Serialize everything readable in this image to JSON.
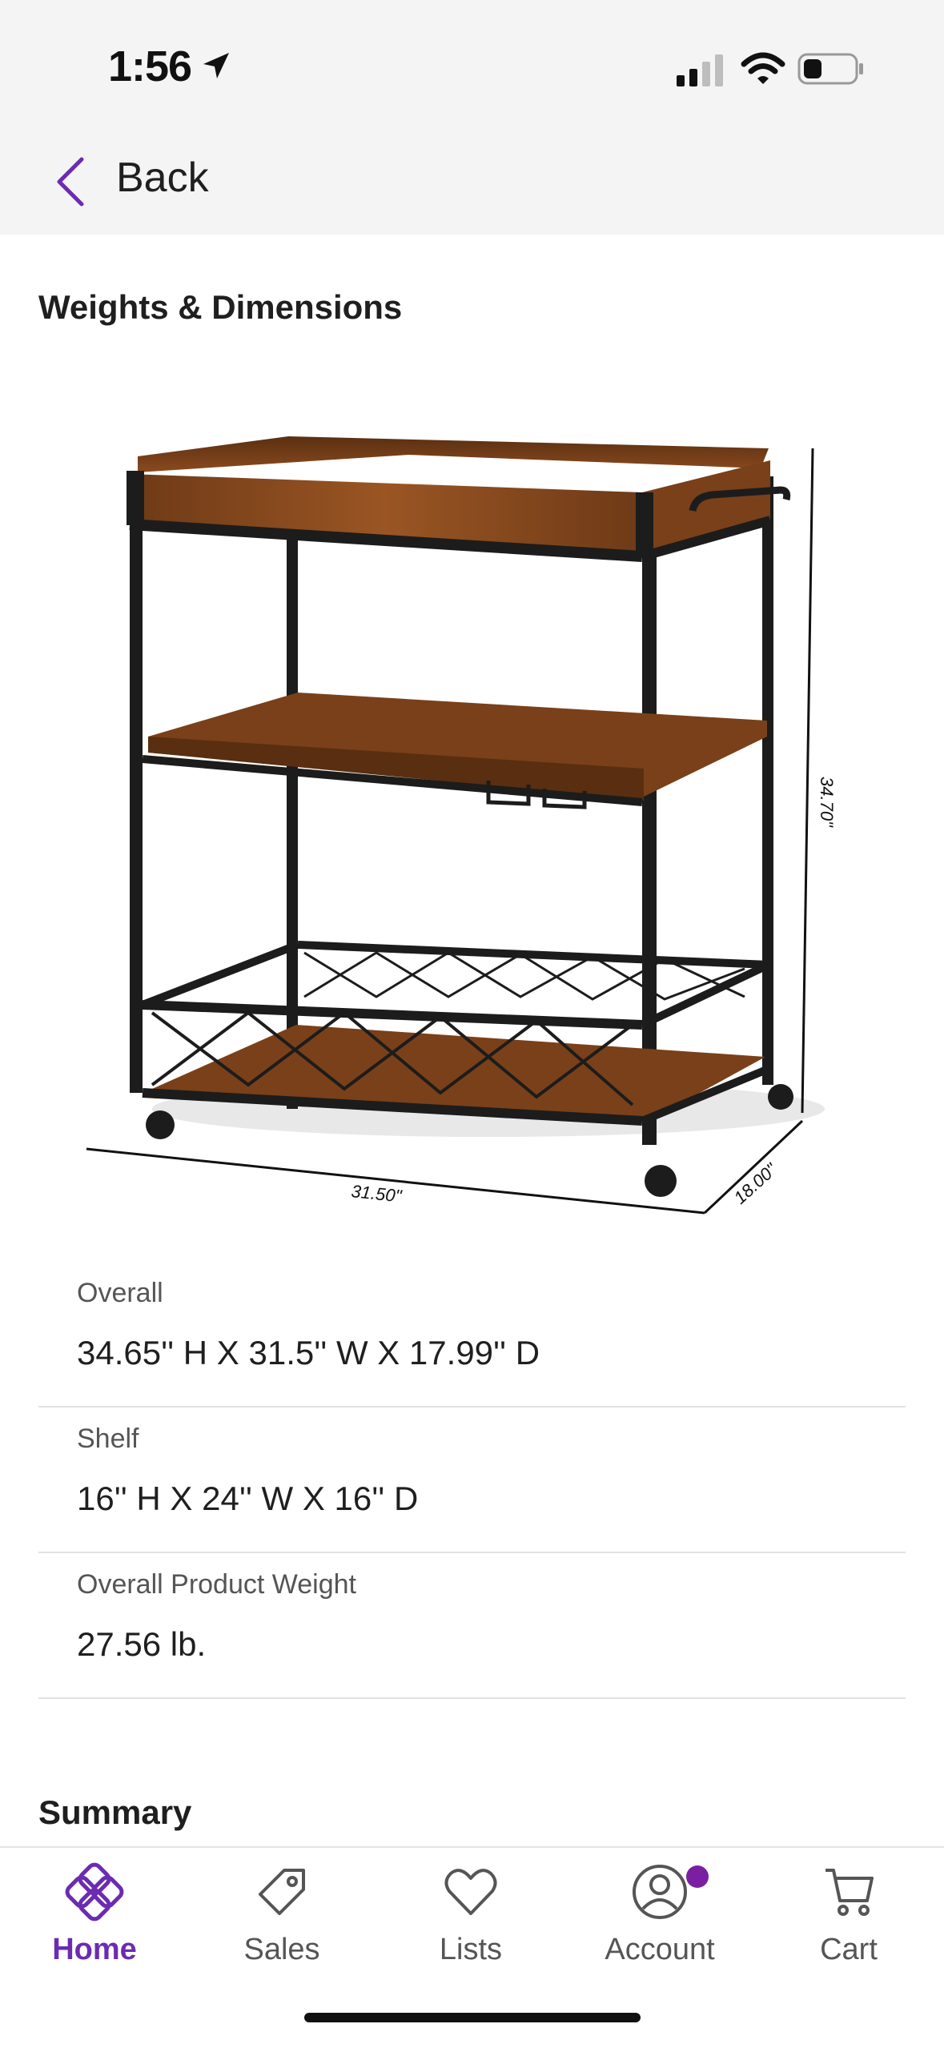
{
  "status_bar": {
    "time": "1:56"
  },
  "nav": {
    "back_label": "Back"
  },
  "section": {
    "title": "Weights & Dimensions"
  },
  "figure": {
    "dim_height": "34.70\"",
    "dim_width": "31.50\"",
    "dim_depth": "18.00\""
  },
  "specs": [
    {
      "label": "Overall",
      "value": "34.65'' H X 31.5'' W X 17.99'' D"
    },
    {
      "label": "Shelf",
      "value": "16'' H X 24'' W X 16'' D"
    },
    {
      "label": "Overall Product Weight",
      "value": "27.56 lb."
    }
  ],
  "summary": {
    "title": "Summary"
  },
  "tabs": [
    {
      "label": "Home",
      "icon": "home-icon",
      "active": true
    },
    {
      "label": "Sales",
      "icon": "tag-icon"
    },
    {
      "label": "Lists",
      "icon": "heart-icon"
    },
    {
      "label": "Account",
      "icon": "account-icon"
    },
    {
      "label": "Cart",
      "icon": "cart-icon"
    }
  ],
  "colors": {
    "accent": "#6c2bb0",
    "wood": "#8b4a1e",
    "metal": "#1c1c1c"
  }
}
